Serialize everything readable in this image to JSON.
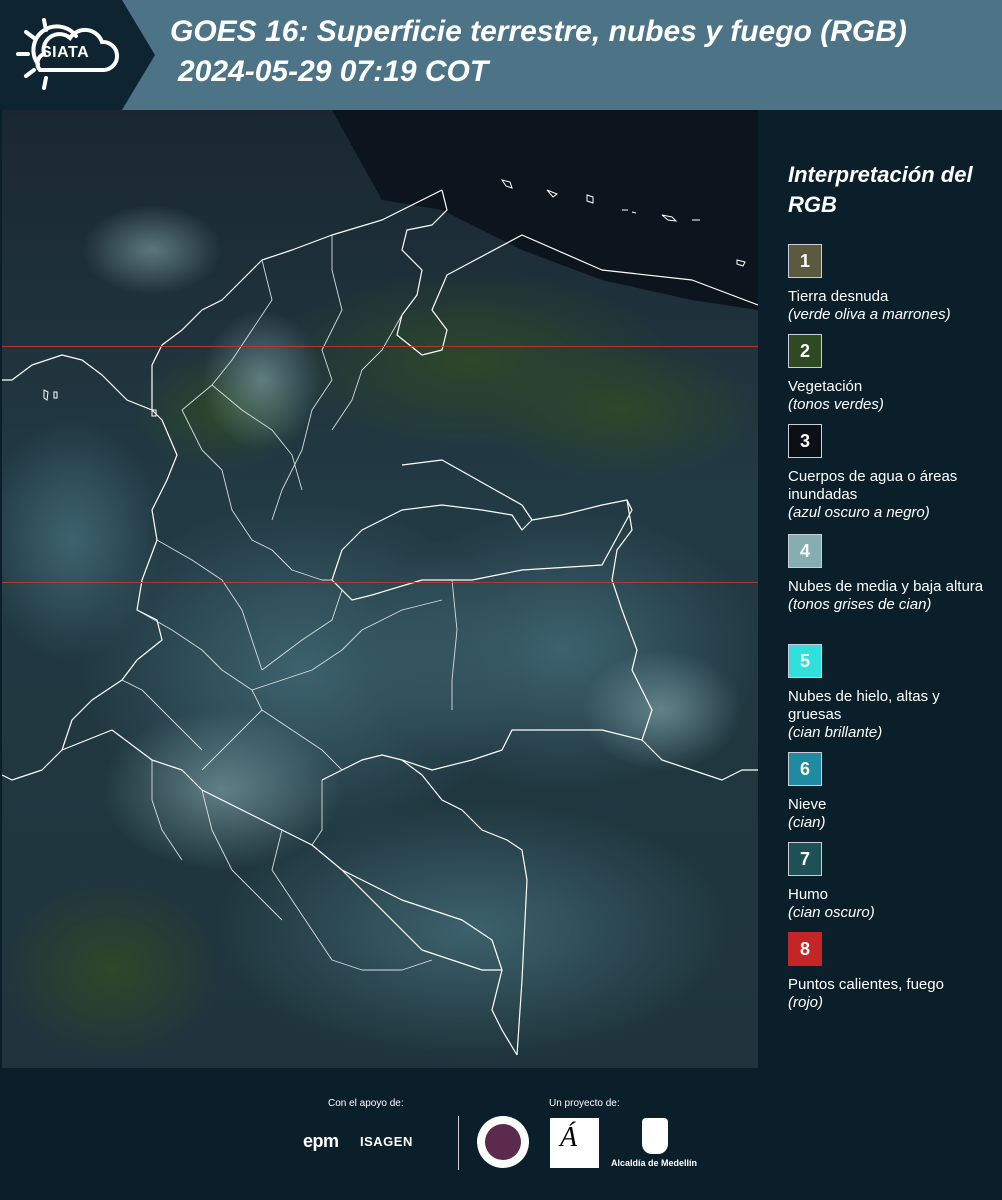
{
  "header": {
    "logo_text": "SIATA",
    "title": "GOES 16: Superficie terrestre, nubes y fuego (RGB)",
    "subtitle": "2024-05-29 07:19 COT"
  },
  "legend": {
    "title": "Interpretación del RGB",
    "items": [
      {
        "num": "1",
        "label": "Tierra desnuda",
        "sub": "(verde oliva a marrones)",
        "color": "#5b5a3e"
      },
      {
        "num": "2",
        "label": "Vegetación",
        "sub": "(tonos verdes)",
        "color": "#2f4a22"
      },
      {
        "num": "3",
        "label": "Cuerpos de agua o áreas inundadas",
        "sub": "(azul oscuro a negro)",
        "color": "#0b1017"
      },
      {
        "num": "4",
        "label": "Nubes de media y baja altura",
        "sub": "(tonos grises de cian)",
        "color": "#86aeb0"
      },
      {
        "num": "5",
        "label": "Nubes de hielo, altas y gruesas",
        "sub": "(cian brillante)",
        "color": "#2fe0dc"
      },
      {
        "num": "6",
        "label": "Nieve",
        "sub": "(cian)",
        "color": "#1f8aa0"
      },
      {
        "num": "7",
        "label": "Humo",
        "sub": "(cian oscuro)",
        "color": "#1e5155"
      },
      {
        "num": "8",
        "label": "Puntos calientes, fuego",
        "sub": "(rojo)",
        "color": "#c42526"
      }
    ]
  },
  "footer": {
    "support_label": "Con el apoyo de:",
    "project_label": "Un proyecto de:",
    "epm": "epm",
    "isagen": "ISAGEN",
    "alcaldia": "Alcaldía de Medellín"
  },
  "colors": {
    "header_bg": "#4c7486",
    "panel_bg": "#0b1f2b",
    "guide_line": "#c0392b"
  }
}
